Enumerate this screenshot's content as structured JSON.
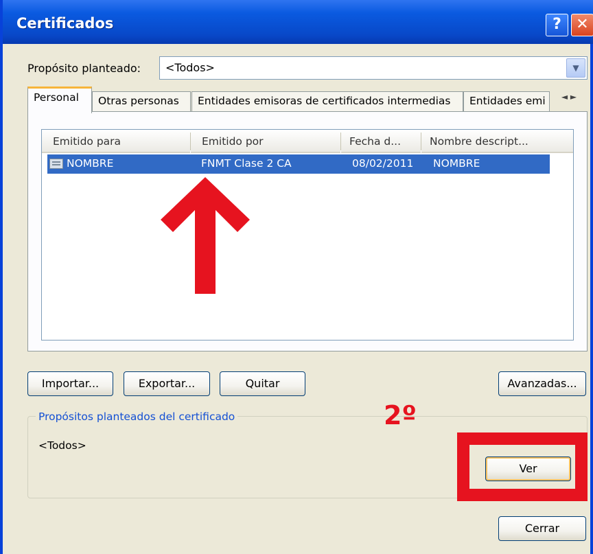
{
  "window": {
    "title": "Certificados",
    "help_glyph": "?",
    "close_glyph": "✕"
  },
  "purpose": {
    "label": "Propósito planteado:",
    "value": "<Todos>"
  },
  "tabs": [
    {
      "label": "Personal",
      "active": true
    },
    {
      "label": "Otras personas"
    },
    {
      "label": "Entidades emisoras de certificados intermedias"
    },
    {
      "label": "Entidades emi"
    }
  ],
  "tab_scroll": {
    "left": "◄",
    "right": "►"
  },
  "table": {
    "headers": [
      "Emitido para",
      "Emitido por",
      "Fecha d...",
      "Nombre descript..."
    ],
    "rows": [
      {
        "issued_to": "NOMBRE",
        "issued_by": "FNMT Clase 2 CA",
        "date": "08/02/2011",
        "friendly_name": "NOMBRE",
        "selected": true
      }
    ]
  },
  "buttons": {
    "import": "Importar...",
    "export": "Exportar...",
    "remove": "Quitar",
    "advanced": "Avanzadas...",
    "view": "Ver",
    "close": "Cerrar"
  },
  "group": {
    "title": "Propósitos planteados del certificado",
    "value": "<Todos>"
  },
  "annotation": {
    "step_label": "2º",
    "color": "#e6131f"
  },
  "colors": {
    "titlebar": "#0a5ae0",
    "selection": "#316ac5",
    "dialog_bg": "#ece9d8"
  }
}
